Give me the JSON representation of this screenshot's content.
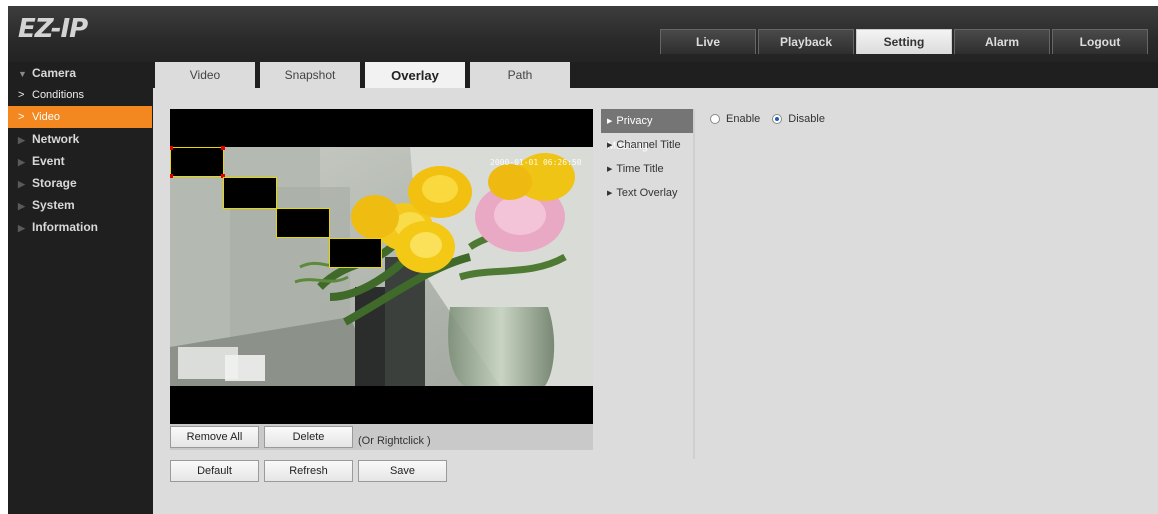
{
  "app": {
    "logo": "EZ-IP"
  },
  "main_nav": [
    "Live",
    "Playback",
    "Setting",
    "Alarm",
    "Logout"
  ],
  "main_nav_active": "Setting",
  "sidebar": {
    "camera": {
      "label": "Camera",
      "children": [
        {
          "label": "Conditions",
          "active": false
        },
        {
          "label": "Video",
          "active": true
        }
      ]
    },
    "others": [
      "Network",
      "Event",
      "Storage",
      "System",
      "Information"
    ]
  },
  "tabs": [
    "Video",
    "Snapshot",
    "Overlay",
    "Path"
  ],
  "tabs_active": "Overlay",
  "preview": {
    "timestamp": "2000-01-01 06:26:50"
  },
  "overlay_menu": [
    "Privacy Masking",
    "Channel Title",
    "Time Title",
    "Text Overlay"
  ],
  "overlay_menu_active": "Privacy Masking",
  "privacy_masking": {
    "enable_label": "Enable",
    "disable_label": "Disable",
    "selected": "Disable"
  },
  "buttons": {
    "remove_all": "Remove All",
    "delete": "Delete",
    "rightclick_hint": "(Or Rightclick )",
    "default": "Default",
    "refresh": "Refresh",
    "save": "Save"
  },
  "colors": {
    "accent": "#f2881f",
    "mask_border": "#e6d700",
    "radio_selected": "#1a5fb4"
  }
}
